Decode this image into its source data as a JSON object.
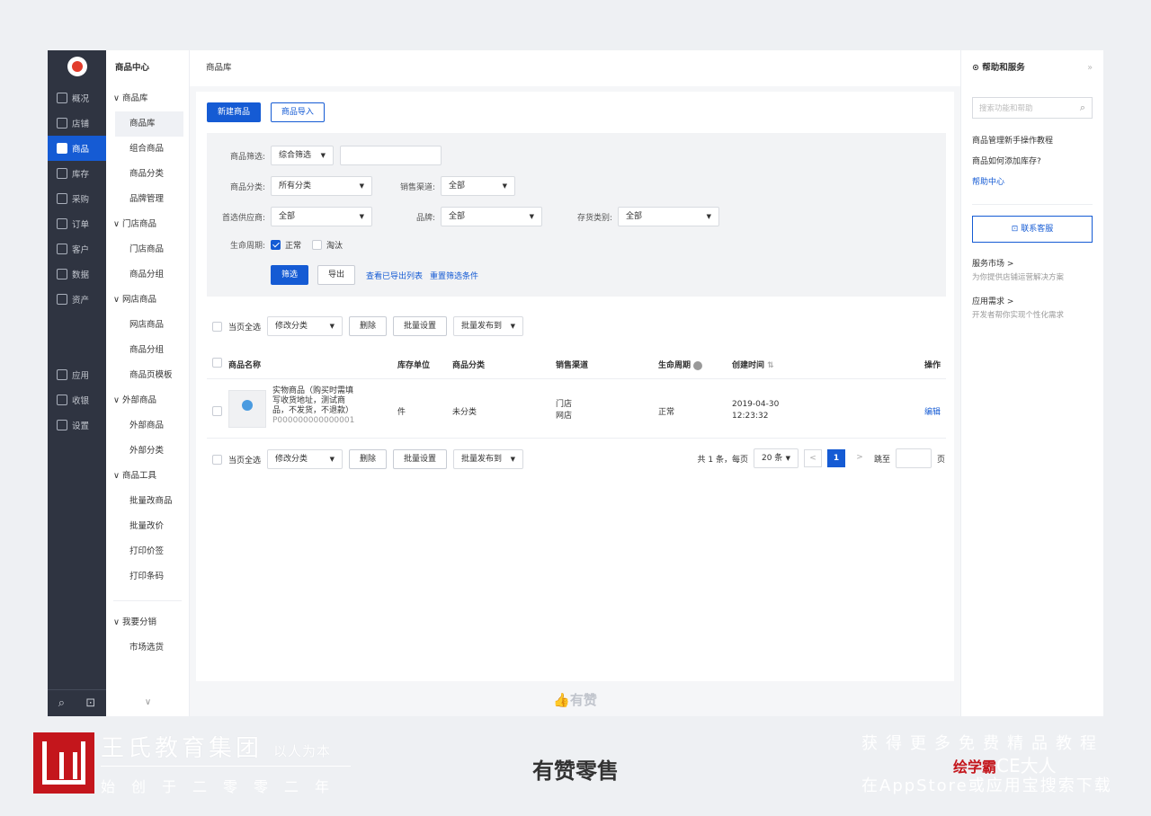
{
  "rail": {
    "items": [
      {
        "label": "概况",
        "icon": "monitor-icon"
      },
      {
        "label": "店铺",
        "icon": "store-icon"
      },
      {
        "label": "商品",
        "icon": "tag-icon",
        "active": true
      },
      {
        "label": "库存",
        "icon": "warehouse-icon"
      },
      {
        "label": "采购",
        "icon": "purchase-icon"
      },
      {
        "label": "订单",
        "icon": "order-icon"
      },
      {
        "label": "客户",
        "icon": "user-icon"
      },
      {
        "label": "数据",
        "icon": "chart-icon"
      },
      {
        "label": "资产",
        "icon": "asset-icon"
      }
    ],
    "items2": [
      {
        "label": "应用",
        "icon": "apps-icon"
      },
      {
        "label": "收银",
        "icon": "cashier-icon"
      },
      {
        "label": "设置",
        "icon": "gear-icon"
      }
    ],
    "bottom": {
      "search": "⌕",
      "chat": "⊡"
    }
  },
  "subnav": {
    "title": "商品中心",
    "entries": [
      {
        "type": "group",
        "label": "∨ 商品库"
      },
      {
        "type": "item",
        "label": "商品库",
        "active": true
      },
      {
        "type": "item",
        "label": "组合商品"
      },
      {
        "type": "item",
        "label": "商品分类"
      },
      {
        "type": "item",
        "label": "品牌管理"
      },
      {
        "type": "group",
        "label": "∨ 门店商品"
      },
      {
        "type": "item",
        "label": "门店商品"
      },
      {
        "type": "item",
        "label": "商品分组"
      },
      {
        "type": "group",
        "label": "∨ 网店商品"
      },
      {
        "type": "item",
        "label": "网店商品"
      },
      {
        "type": "item",
        "label": "商品分组"
      },
      {
        "type": "item",
        "label": "商品页模板"
      },
      {
        "type": "group",
        "label": "∨ 外部商品"
      },
      {
        "type": "item",
        "label": "外部商品"
      },
      {
        "type": "item",
        "label": "外部分类"
      },
      {
        "type": "group",
        "label": "∨ 商品工具"
      },
      {
        "type": "item",
        "label": "批量改商品"
      },
      {
        "type": "item",
        "label": "批量改价"
      },
      {
        "type": "item",
        "label": "打印价签"
      },
      {
        "type": "item",
        "label": "打印条码"
      }
    ],
    "extra_group": "∨ 我要分销",
    "extra_item": "市场选货",
    "foot": "∨"
  },
  "main": {
    "breadcrumb": "商品库",
    "new_button": "新建商品",
    "import_button": "商品导入",
    "filter": {
      "goods_filter_label": "商品筛选:",
      "goods_filter_value": "综合筛选",
      "goods_filter_input": "",
      "category_label": "商品分类:",
      "category_value": "所有分类",
      "channel_label": "销售渠道:",
      "channel_value": "全部",
      "supplier_label": "首选供应商:",
      "supplier_value": "全部",
      "brand_label": "品牌:",
      "brand_value": "全部",
      "stock_type_label": "存货类别:",
      "stock_type_value": "全部",
      "lifecycle_label": "生命周期:",
      "lifecycle_normal": "正常",
      "lifecycle_eliminated": "淘汰",
      "filter_button": "筛选",
      "export_button": "导出",
      "view_exports_link": "查看已导出列表",
      "reset_link": "重置筛选条件"
    },
    "batch": {
      "select_all": "当页全选",
      "modify_category": "修改分类",
      "delete": "删除",
      "batch_settings": "批量设置",
      "batch_publish": "批量发布到"
    },
    "table": {
      "headers": {
        "name": "商品名称",
        "unit": "库存单位",
        "category": "商品分类",
        "channel": "销售渠道",
        "lifecycle": "生命周期",
        "created": "创建时间",
        "action": "操作"
      },
      "rows": [
        {
          "name_line1": "实物商品（购买时需填",
          "name_line2": "写收货地址，测试商",
          "name_line3": "品，不发货，不退款）",
          "code": "P000000000000001",
          "unit": "件",
          "category": "未分类",
          "channel_line1": "门店",
          "channel_line2": "网店",
          "lifecycle": "正常",
          "created_date": "2019-04-30",
          "created_time": "12:23:32",
          "action": "编辑"
        }
      ]
    },
    "pager": {
      "summary": "共 1 条，每页",
      "page_size": "20 条",
      "prev": "<",
      "current": "1",
      "next": ">",
      "goto_label": "跳至",
      "goto_value": "",
      "page_unit": "页"
    },
    "footer_brand": "有赞"
  },
  "help": {
    "title": "帮助和服务",
    "expand": "»",
    "search_placeholder": "搜索功能和帮助",
    "links": [
      "商品管理新手操作教程",
      "商品如何添加库存?"
    ],
    "help_center": "帮助中心",
    "contact_button": "联系客服",
    "market_title": "服务市场 >",
    "market_desc": "为你提供店铺运营解决方案",
    "app_title": "应用需求 >",
    "app_desc": "开发者帮你实现个性化需求"
  },
  "banner": {
    "org_name": "王氏教育集团",
    "motto": "以人为本",
    "since": "始创于二零零二年",
    "center_title": "有赞零售",
    "right_line1": "获得更多免费精品教程",
    "right_line2": "在AppStore或应用宝搜索下载",
    "watermark_red": "绘学霸",
    "watermark": "CE大人"
  },
  "colors": {
    "accent": "#155bd4",
    "rail_bg": "#2f3441",
    "brand_red": "#c4161c"
  }
}
